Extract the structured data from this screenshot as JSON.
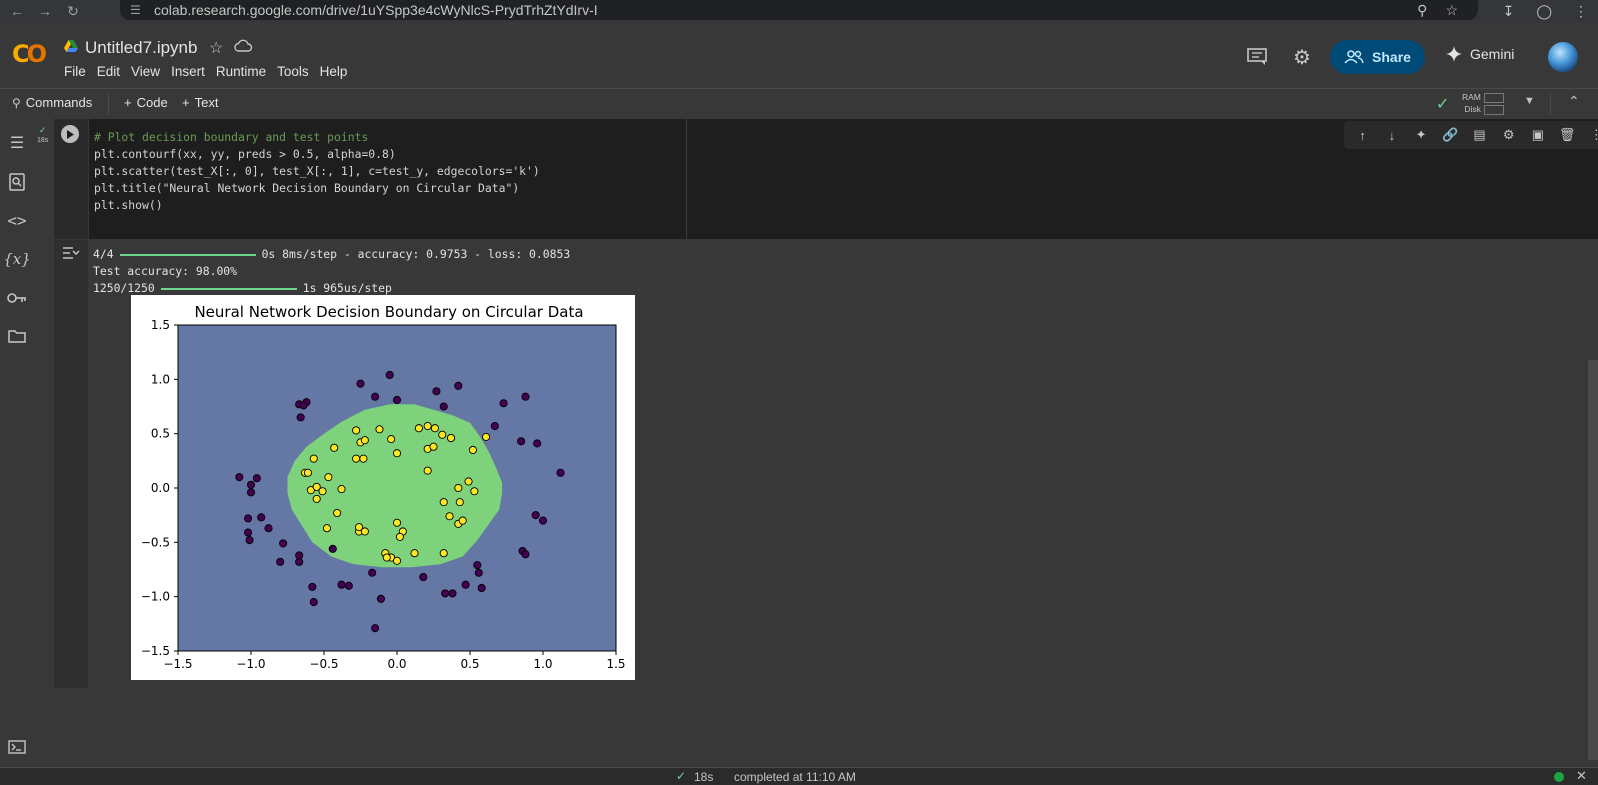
{
  "browser": {
    "url": "colab.research.google.com/drive/1uYSpp3e4cWyNlcS-PrydTrhZtYdIrv-I"
  },
  "header": {
    "logo_text": "CO",
    "notebook_title": "Untitled7.ipynb",
    "menu": [
      "File",
      "Edit",
      "View",
      "Insert",
      "Runtime",
      "Tools",
      "Help"
    ],
    "share_label": "Share",
    "gemini_label": "Gemini"
  },
  "toolbar": {
    "commands_label": "Commands",
    "code_label": "Code",
    "text_label": "Text",
    "ram_label": "RAM",
    "disk_label": "Disk"
  },
  "cell": {
    "exec_time": "18s",
    "code": [
      "# Plot decision boundary and test points",
      "plt.contourf(xx, yy, preds > 0.5, alpha=0.8)",
      "plt.scatter(test_X[:, 0], test_X[:, 1], c=test_y, edgecolors='k')",
      "plt.title(\"Neural Network Decision Boundary on Circular Data\")",
      "plt.show()"
    ],
    "output": {
      "line1_left": "4/4",
      "line1_right": "0s 8ms/step - accuracy: 0.9753 - loss: 0.0853",
      "line2": "Test accuracy: 98.00%",
      "line3_left": "1250/1250",
      "line3_right": "1s 965us/step"
    }
  },
  "colors": {
    "region_outer": "#6577a4",
    "region_inner": "#7ed27c",
    "class0": "#440154",
    "class1": "#fde725",
    "accent_green": "#6dd58c",
    "share_bg": "#004a77"
  },
  "chart_data": {
    "type": "scatter",
    "title": "Neural Network Decision Boundary on Circular Data",
    "xlabel": "",
    "ylabel": "",
    "xlim": [
      -1.5,
      1.5
    ],
    "ylim": [
      -1.5,
      1.5
    ],
    "xticks": [
      "−1.5",
      "−1.0",
      "−0.5",
      "0.0",
      "0.5",
      "1.0",
      "1.5"
    ],
    "yticks": [
      "−1.5",
      "−1.0",
      "−0.5",
      "0.0",
      "0.5",
      "1.0",
      "1.5"
    ],
    "xtick_values": [
      -1.5,
      -1.0,
      -0.5,
      0.0,
      0.5,
      1.0,
      1.5
    ],
    "ytick_values": [
      -1.5,
      -1.0,
      -0.5,
      0.0,
      0.5,
      1.0,
      1.5
    ],
    "background_region": "class 0 (outer)",
    "decision_region_polygon": [
      [
        -0.05,
        0.77
      ],
      [
        0.12,
        0.77
      ],
      [
        0.25,
        0.72
      ],
      [
        0.38,
        0.67
      ],
      [
        0.5,
        0.6
      ],
      [
        0.57,
        0.47
      ],
      [
        0.63,
        0.33
      ],
      [
        0.68,
        0.18
      ],
      [
        0.72,
        0.05
      ],
      [
        0.72,
        -0.05
      ],
      [
        0.7,
        -0.2
      ],
      [
        0.63,
        -0.33
      ],
      [
        0.55,
        -0.48
      ],
      [
        0.45,
        -0.63
      ],
      [
        0.3,
        -0.7
      ],
      [
        0.1,
        -0.73
      ],
      [
        -0.1,
        -0.73
      ],
      [
        -0.3,
        -0.7
      ],
      [
        -0.45,
        -0.63
      ],
      [
        -0.58,
        -0.5
      ],
      [
        -0.65,
        -0.35
      ],
      [
        -0.72,
        -0.2
      ],
      [
        -0.75,
        -0.05
      ],
      [
        -0.75,
        0.1
      ],
      [
        -0.7,
        0.25
      ],
      [
        -0.62,
        0.38
      ],
      [
        -0.5,
        0.5
      ],
      [
        -0.38,
        0.61
      ],
      [
        -0.22,
        0.72
      ]
    ],
    "series": [
      {
        "name": "class 0",
        "points": [
          [
            -0.62,
            0.79
          ],
          [
            -0.67,
            0.77
          ],
          [
            -0.64,
            0.76
          ],
          [
            -0.66,
            0.65
          ],
          [
            -0.25,
            0.96
          ],
          [
            -0.15,
            0.84
          ],
          [
            -0.05,
            1.04
          ],
          [
            0.0,
            0.81
          ],
          [
            0.27,
            0.89
          ],
          [
            0.32,
            0.75
          ],
          [
            0.42,
            0.94
          ],
          [
            0.73,
            0.78
          ],
          [
            0.67,
            0.57
          ],
          [
            0.85,
            0.43
          ],
          [
            0.88,
            0.84
          ],
          [
            0.96,
            0.41
          ],
          [
            1.12,
            0.14
          ],
          [
            -1.08,
            0.1
          ],
          [
            -1.0,
            0.03
          ],
          [
            -0.96,
            0.09
          ],
          [
            -1.0,
            -0.04
          ],
          [
            -1.02,
            -0.28
          ],
          [
            -1.02,
            -0.41
          ],
          [
            -1.01,
            -0.48
          ],
          [
            -0.93,
            -0.27
          ],
          [
            -0.88,
            -0.37
          ],
          [
            -0.78,
            -0.51
          ],
          [
            -0.8,
            -0.68
          ],
          [
            -0.67,
            -0.68
          ],
          [
            -0.67,
            -0.62
          ],
          [
            -0.44,
            -0.56
          ],
          [
            -0.58,
            -0.91
          ],
          [
            -0.57,
            -1.05
          ],
          [
            -0.38,
            -0.89
          ],
          [
            -0.33,
            -0.9
          ],
          [
            -0.17,
            -0.78
          ],
          [
            -0.11,
            -1.02
          ],
          [
            -0.15,
            -1.29
          ],
          [
            0.18,
            -0.82
          ],
          [
            0.33,
            -0.97
          ],
          [
            0.38,
            -0.97
          ],
          [
            0.47,
            -0.89
          ],
          [
            0.55,
            -0.71
          ],
          [
            0.56,
            -0.78
          ],
          [
            0.58,
            -0.92
          ],
          [
            0.86,
            -0.58
          ],
          [
            0.88,
            -0.61
          ],
          [
            0.95,
            -0.25
          ],
          [
            1.0,
            -0.3
          ]
        ]
      },
      {
        "name": "class 1",
        "points": [
          [
            -0.12,
            0.54
          ],
          [
            0.15,
            0.55
          ],
          [
            0.21,
            0.57
          ],
          [
            0.26,
            0.55
          ],
          [
            0.31,
            0.49
          ],
          [
            0.37,
            0.46
          ],
          [
            0.61,
            0.47
          ],
          [
            0.37,
            0.46
          ],
          [
            -0.04,
            0.45
          ],
          [
            -0.28,
            0.53
          ],
          [
            -0.25,
            0.42
          ],
          [
            -0.22,
            0.44
          ],
          [
            -0.43,
            0.37
          ],
          [
            -0.28,
            0.27
          ],
          [
            -0.23,
            0.27
          ],
          [
            -0.57,
            0.27
          ],
          [
            -0.63,
            0.14
          ],
          [
            -0.61,
            0.14
          ],
          [
            -0.47,
            0.1
          ],
          [
            -0.59,
            -0.02
          ],
          [
            -0.55,
            0.01
          ],
          [
            -0.51,
            -0.03
          ],
          [
            -0.55,
            -0.1
          ],
          [
            -0.38,
            -0.01
          ],
          [
            -0.48,
            -0.37
          ],
          [
            -0.41,
            -0.23
          ],
          [
            -0.26,
            -0.4
          ],
          [
            -0.26,
            -0.36
          ],
          [
            -0.22,
            -0.4
          ],
          [
            0.0,
            0.32
          ],
          [
            0.21,
            0.36
          ],
          [
            0.25,
            0.38
          ],
          [
            0.21,
            0.16
          ],
          [
            0.52,
            0.35
          ],
          [
            0.49,
            0.06
          ],
          [
            0.53,
            -0.03
          ],
          [
            0.42,
            0.0
          ],
          [
            0.43,
            -0.13
          ],
          [
            0.32,
            -0.13
          ],
          [
            0.36,
            -0.26
          ],
          [
            0.42,
            -0.33
          ],
          [
            0.45,
            -0.3
          ],
          [
            0.0,
            -0.32
          ],
          [
            0.04,
            -0.4
          ],
          [
            0.02,
            -0.45
          ],
          [
            -0.08,
            -0.6
          ],
          [
            -0.04,
            -0.64
          ],
          [
            -0.07,
            -0.64
          ],
          [
            0.0,
            -0.67
          ],
          [
            0.12,
            -0.6
          ],
          [
            0.32,
            -0.6
          ]
        ]
      }
    ]
  }
}
